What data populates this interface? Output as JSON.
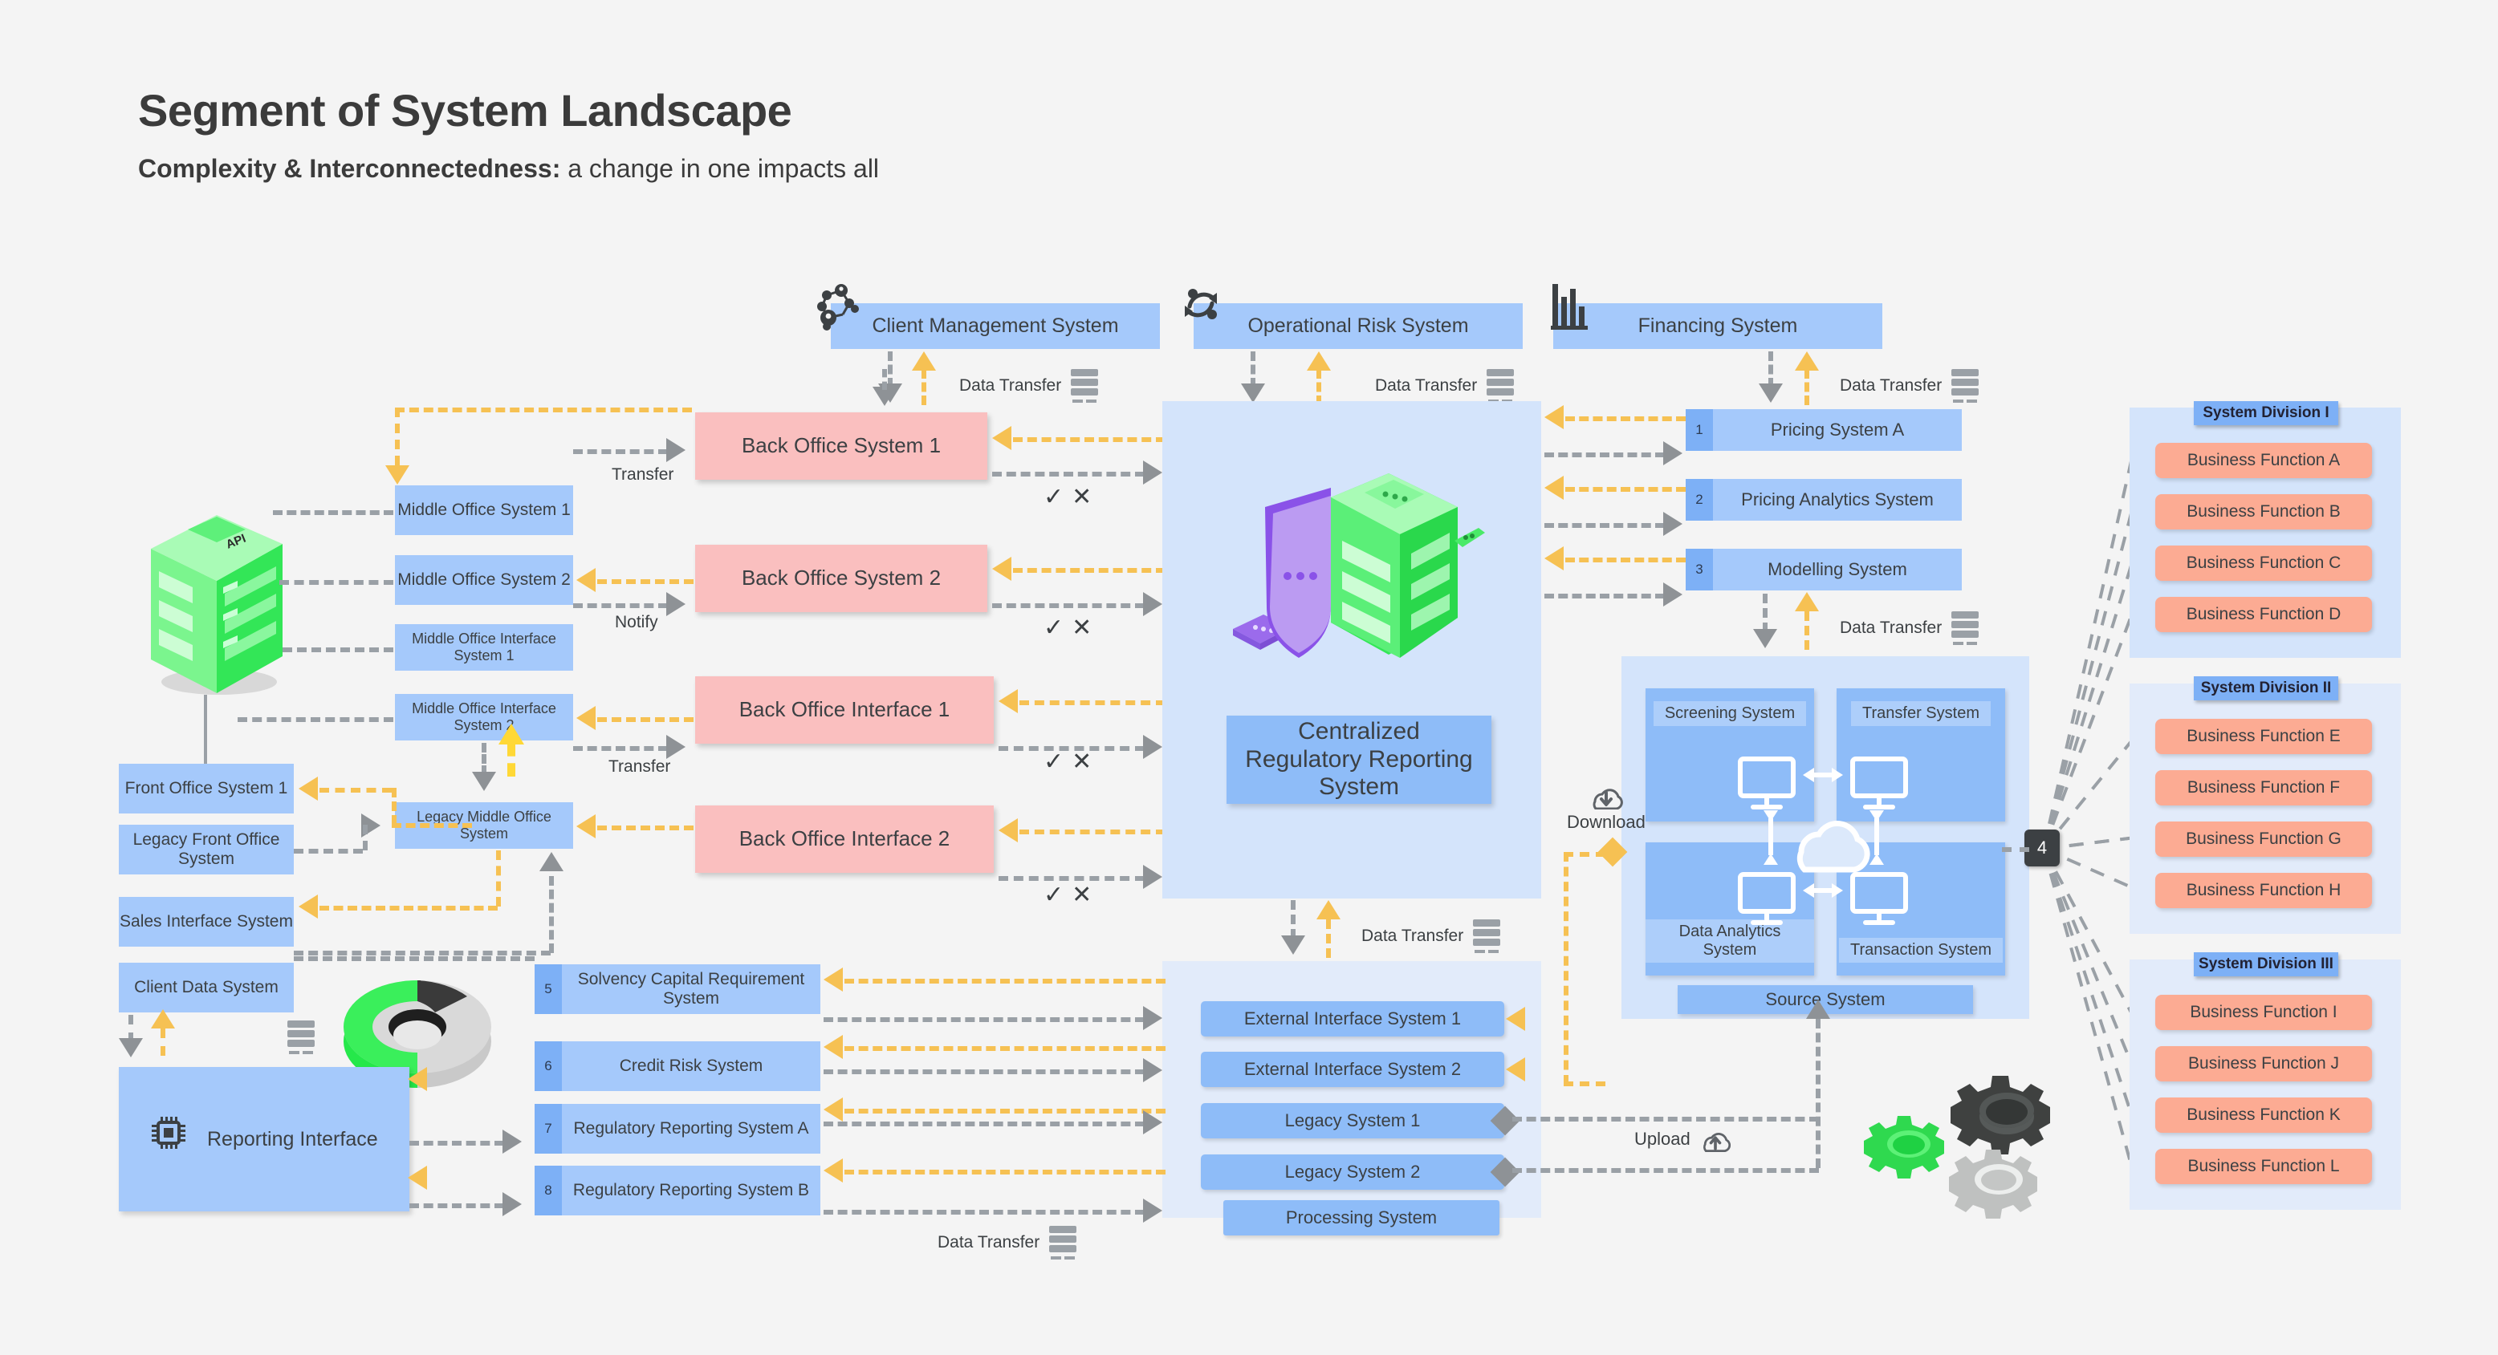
{
  "title": "Segment of System Landscape",
  "subtitle_lead": "Complexity & Interconnectedness:",
  "subtitle_rest": " a change in one impacts all",
  "colors": {
    "background": "#f4f4f4",
    "blue_box": "#a5c9fb",
    "blue_bar": "#8ebcf8",
    "pink_box": "#fabfbf",
    "salmon_box": "#fcab93",
    "panel": "#d4e4fb",
    "accent_orange": "#f6c153",
    "grey_line": "#9aa0a6",
    "green": "#3ded5a",
    "purple": "#a97ef0"
  },
  "top_systems": [
    {
      "label": "Client Management System",
      "icon": "network-people-icon"
    },
    {
      "label": "Operational Risk System",
      "icon": "refresh-cycle-icon"
    },
    {
      "label": "Financing System",
      "icon": "bar-chart-icon"
    }
  ],
  "data_transfer_label": "Data Transfer",
  "data_transfer_icon": "server-stack-icon",
  "middle_office": [
    {
      "label": "Middle Office System 1"
    },
    {
      "label": "Middle Office System 2"
    },
    {
      "label": "Middle Office Interface System 1"
    },
    {
      "label": "Middle Office Interface System 2"
    },
    {
      "label": "Legacy Middle Office System"
    }
  ],
  "front_office": [
    {
      "label": "Front Office System 1"
    },
    {
      "label": "Legacy Front Office System"
    },
    {
      "label": "Sales Interface System"
    },
    {
      "label": "Client Data System"
    }
  ],
  "reporting_interface": {
    "label": "Reporting Interface",
    "icon": "chip-icon"
  },
  "api_server": {
    "label": "API",
    "icon": "server-tower-icon"
  },
  "back_office": [
    {
      "label": "Back Office System 1"
    },
    {
      "label": "Back Office System 2"
    },
    {
      "label": "Back Office Interface 1"
    },
    {
      "label": "Back Office Interface 2"
    }
  ],
  "edge_labels": {
    "transfer": "Transfer",
    "notify": "Notify",
    "transfer2": "Transfer",
    "check_mark": "✓",
    "cross_mark": "✕"
  },
  "center_panel": {
    "title": "Centralized Regulatory Reporting System",
    "illustration": "shield-and-server-icon"
  },
  "numbered_systems": [
    {
      "number": "1",
      "label": "Pricing System A"
    },
    {
      "number": "2",
      "label": "Pricing Analytics System"
    },
    {
      "number": "3",
      "label": "Modelling System"
    },
    {
      "number": "5",
      "label": "Solvency Capital Requirement System"
    },
    {
      "number": "6",
      "label": "Credit Risk System"
    },
    {
      "number": "7",
      "label": "Regulatory Reporting System A"
    },
    {
      "number": "8",
      "label": "Regulatory Reporting System B"
    }
  ],
  "bottom_center_systems": [
    {
      "label": "External Interface System 1"
    },
    {
      "label": "External Interface System 2"
    },
    {
      "label": "Legacy System 1"
    },
    {
      "label": "Legacy System 2"
    },
    {
      "label": "Processing System"
    }
  ],
  "source_system": {
    "footer_label": "Source System",
    "quadrants": [
      {
        "label": "Screening System"
      },
      {
        "label": "Transfer System"
      },
      {
        "label": "Data Analytics System"
      },
      {
        "label": "Transaction System"
      }
    ],
    "cloud_icon": "cloud-icon",
    "monitor_icon": "monitor-icon"
  },
  "transfer_actions": [
    {
      "label": "Download",
      "icon": "cloud-download-icon"
    },
    {
      "label": "Upload",
      "icon": "cloud-upload-icon"
    }
  ],
  "hub_badge": "4",
  "gears_icon": "gears-icon",
  "divisions": [
    {
      "title": "System Division I",
      "functions": [
        "Business Function A",
        "Business Function B",
        "Business Function C",
        "Business Function D"
      ]
    },
    {
      "title": "System Division II",
      "functions": [
        "Business Function E",
        "Business Function F",
        "Business Function G",
        "Business Function H"
      ]
    },
    {
      "title": "System Division III",
      "functions": [
        "Business Function I",
        "Business Function J",
        "Business Function K",
        "Business Function L"
      ]
    }
  ]
}
